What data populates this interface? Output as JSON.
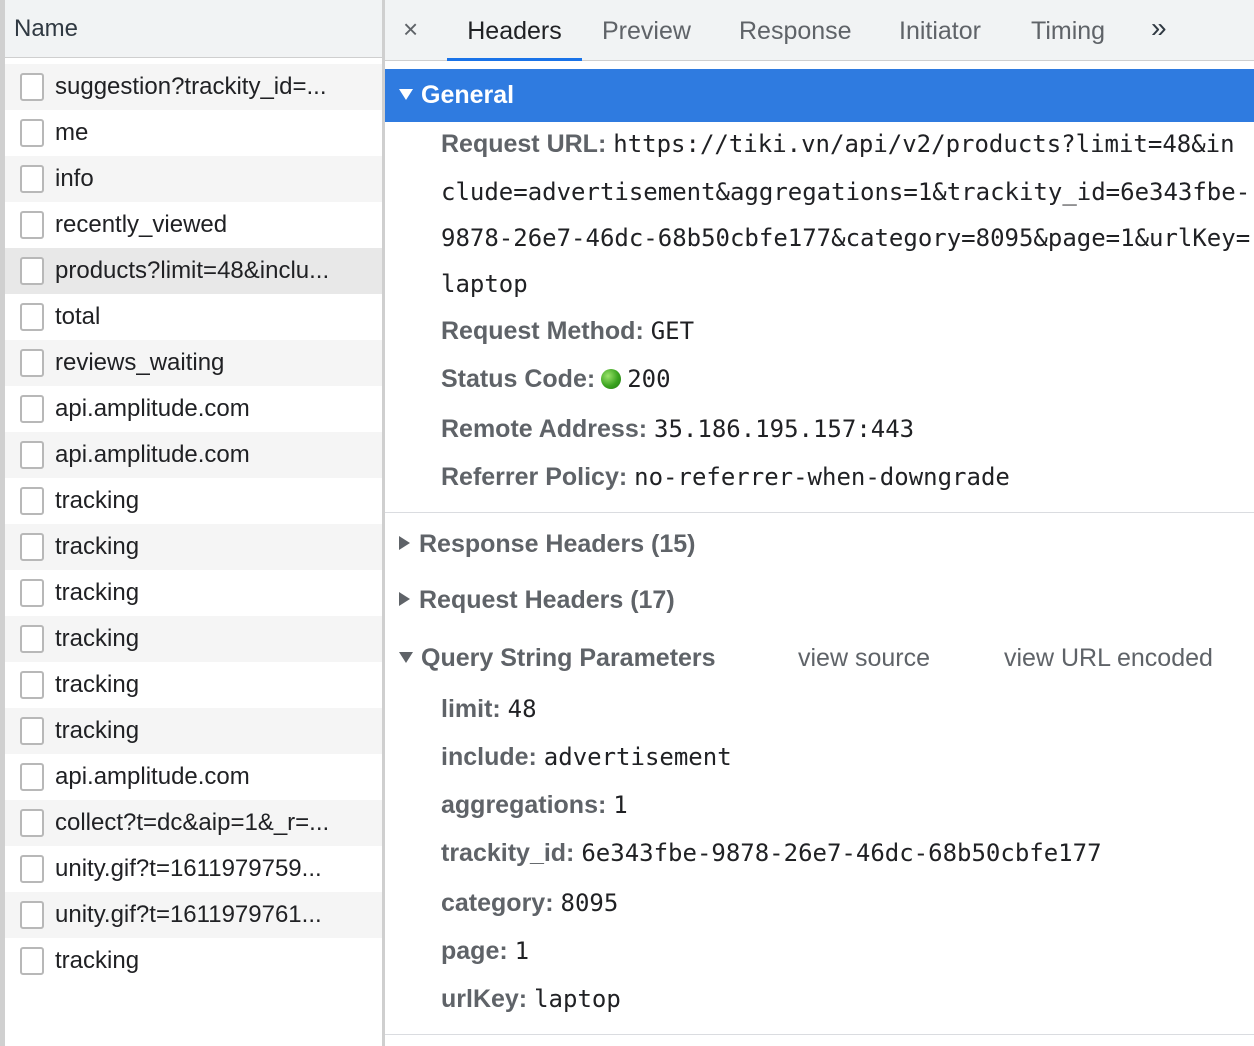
{
  "list": {
    "header": "Name",
    "rows": [
      {
        "name": "suggestion?trackity_id=..."
      },
      {
        "name": "me"
      },
      {
        "name": "info"
      },
      {
        "name": "recently_viewed"
      },
      {
        "name": "products?limit=48&inclu..."
      },
      {
        "name": "total"
      },
      {
        "name": "reviews_waiting"
      },
      {
        "name": "api.amplitude.com"
      },
      {
        "name": "api.amplitude.com"
      },
      {
        "name": "tracking"
      },
      {
        "name": "tracking"
      },
      {
        "name": "tracking"
      },
      {
        "name": "tracking"
      },
      {
        "name": "tracking"
      },
      {
        "name": "tracking"
      },
      {
        "name": "api.amplitude.com"
      },
      {
        "name": "collect?t=dc&aip=1&_r=..."
      },
      {
        "name": "unity.gif?t=1611979759..."
      },
      {
        "name": "unity.gif?t=1611979761..."
      },
      {
        "name": "tracking"
      }
    ],
    "selected_index": 4
  },
  "tabs": {
    "close": "×",
    "items": [
      "Headers",
      "Preview",
      "Response",
      "Initiator",
      "Timing"
    ],
    "active": "Headers",
    "more": "»"
  },
  "general": {
    "title": "General",
    "request_url_label": "Request URL:",
    "request_url_lines": [
      "https://tiki.vn/api/v2/products?limit=48&in",
      "clude=advertisement&aggregations=1&trackity_id=6e343fbe-",
      "9878-26e7-46dc-68b50cbfe177&category=8095&page=1&urlKey=",
      "laptop"
    ],
    "method_label": "Request Method:",
    "method": "GET",
    "status_label": "Status Code:",
    "status": "200",
    "status_color": "#3aa31f",
    "remote_label": "Remote Address:",
    "remote": "35.186.195.157:443",
    "referrer_label": "Referrer Policy:",
    "referrer": "no-referrer-when-downgrade"
  },
  "response_headers": "Response Headers (15)",
  "request_headers": "Request Headers (17)",
  "query": {
    "title": "Query String Parameters",
    "view_source": "view source",
    "view_url_encoded": "view URL encoded",
    "params": [
      {
        "key": "limit:",
        "value": "48"
      },
      {
        "key": "include:",
        "value": "advertisement"
      },
      {
        "key": "aggregations:",
        "value": "1"
      },
      {
        "key": "trackity_id:",
        "value": "6e343fbe-9878-26e7-46dc-68b50cbfe177"
      },
      {
        "key": "category:",
        "value": "8095"
      },
      {
        "key": "page:",
        "value": "1"
      },
      {
        "key": "urlKey:",
        "value": "laptop"
      }
    ]
  },
  "colors": {
    "accent": "#2f7be0",
    "tab_underline": "#1a73e8"
  }
}
